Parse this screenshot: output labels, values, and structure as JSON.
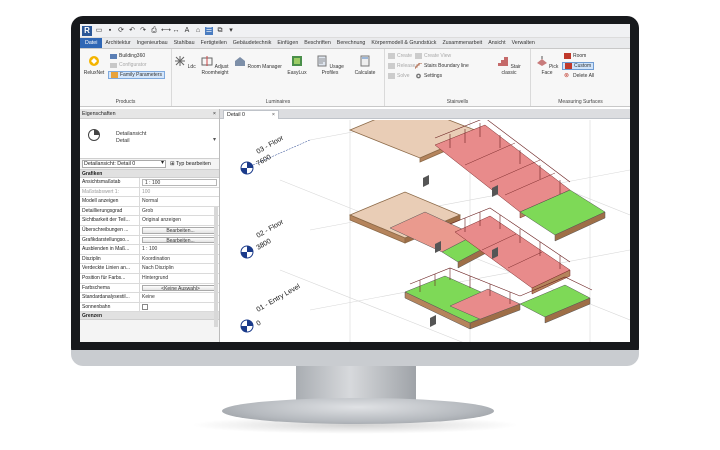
{
  "titlebar": {
    "app_icon_letter": "R"
  },
  "tabs": [
    "Datei",
    "Architektur",
    "Ingenieurbau",
    "Stahlbau",
    "Fertigteilen",
    "Gebäudetechnik",
    "Einfügen",
    "Beschriften",
    "Berechnung",
    "Körpermodell & Grundstück",
    "Zusammenarbeit",
    "Ansicht",
    "Verwalten"
  ],
  "ribbon": {
    "products": {
      "label": "Products",
      "big_buttons": [
        "ReluxNet"
      ],
      "small_buttons": [
        "Building360",
        "Configurator",
        "Family Parameters"
      ]
    },
    "luminaires": {
      "label": "Luminaires",
      "big_buttons": [
        "Ldc",
        "Adjust Roomheight",
        "Room Manager",
        "EasyLux",
        "Usage Profiles",
        "Calculate"
      ]
    },
    "stairwells": {
      "label": "Stairwells",
      "small_buttons": [
        "Create",
        "Release",
        "Solve",
        "Create View",
        "Stairs Boundary line",
        "Settings"
      ],
      "big_buttons": [
        "Stair classic"
      ]
    },
    "measuring": {
      "label": "Measuring Surfaces",
      "big_buttons": [
        "Pick Face"
      ],
      "small_buttons": [
        "Room",
        "Custom",
        "Delete All"
      ]
    }
  },
  "properties": {
    "title": "Eigenschaften",
    "close_glyph": "×",
    "type_name_line1": "Detailansicht",
    "type_name_line2": "Detail",
    "instance_selector": "Detailansicht: Detail 0",
    "edit_type": "Typ bearbeiten",
    "group_graphics": "Grafiken",
    "rows": [
      {
        "k": "Ansichtsmaßstab",
        "v": "1 : 100"
      },
      {
        "k": "Maßstabswert 1:",
        "v": "100"
      },
      {
        "k": "Modell anzeigen",
        "v": "Normal"
      },
      {
        "k": "Detaillierungsgrad",
        "v": "Grob"
      },
      {
        "k": "Sichtbarkeit der Teil...",
        "v": "Original anzeigen"
      },
      {
        "k": "Überschreibungen ...",
        "v": "Bearbeiten..."
      },
      {
        "k": "Grafikdarstellungso...",
        "v": "Bearbeiten..."
      },
      {
        "k": "Ausblenden in Maß...",
        "v": "1 : 100"
      },
      {
        "k": "Disziplin",
        "v": "Koordination"
      },
      {
        "k": "Verdeckte Linien an...",
        "v": "Nach Disziplin"
      },
      {
        "k": "Position für Farbs...",
        "v": "Hintergrund"
      },
      {
        "k": "Farbschema",
        "v": "<Keine Auswahl>"
      },
      {
        "k": "Standardanalysestil...",
        "v": "Keine"
      },
      {
        "k": "Sonnenbahn",
        "v": ""
      }
    ],
    "group_extents": "Grenzen"
  },
  "view": {
    "tab_label": "Detail 0",
    "close_glyph": "×",
    "levels": [
      {
        "name": "03 - Floor",
        "elev": "7600"
      },
      {
        "name": "02 - Floor",
        "elev": "3800"
      },
      {
        "name": "01 - Entry Level",
        "elev": "0"
      }
    ]
  }
}
